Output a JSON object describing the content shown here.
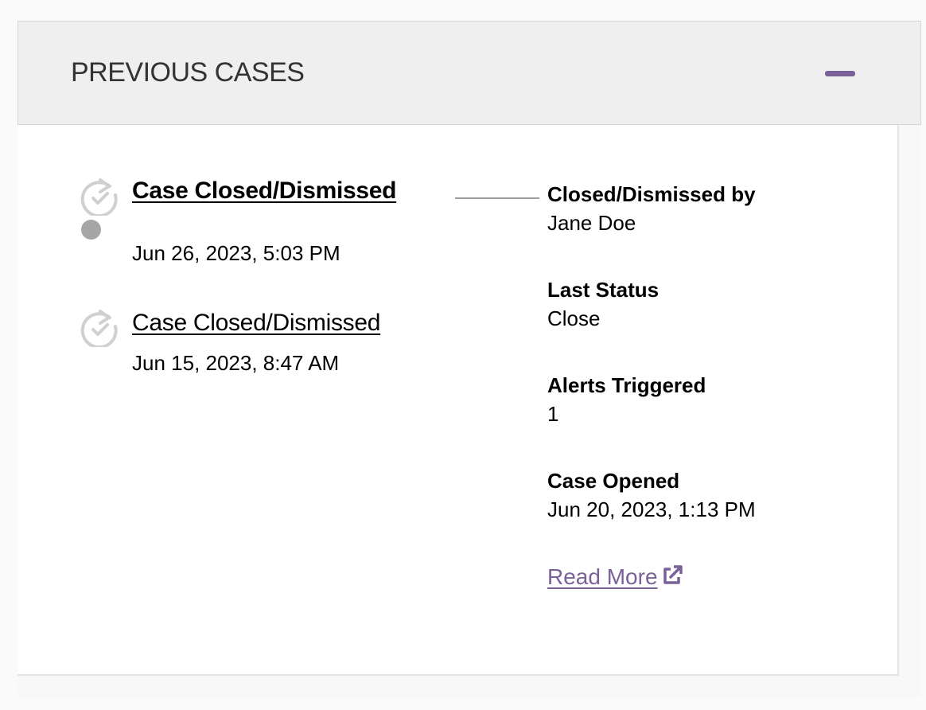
{
  "panel": {
    "title": "PREVIOUS CASES",
    "accent_color": "#7a6199"
  },
  "cases": [
    {
      "title": "Case Closed/Dismissed",
      "date": "Jun 26, 2023, 5:03 PM",
      "selected": true
    },
    {
      "title": "Case Closed/Dismissed",
      "date": "Jun 15, 2023, 8:47 AM",
      "selected": false
    }
  ],
  "details": {
    "closed_by_label": "Closed/Dismissed by",
    "closed_by_value": "Jane Doe",
    "last_status_label": "Last Status",
    "last_status_value": "Close",
    "alerts_label": "Alerts Triggered",
    "alerts_value": "1",
    "case_opened_label": "Case Opened",
    "case_opened_value": "Jun 20, 2023, 1:13 PM",
    "read_more_label": "Read More",
    "read_more_icon": "external-link-icon"
  },
  "icons": {
    "case_icon": "refresh-check-icon",
    "collapse_icon": "minus-icon"
  }
}
